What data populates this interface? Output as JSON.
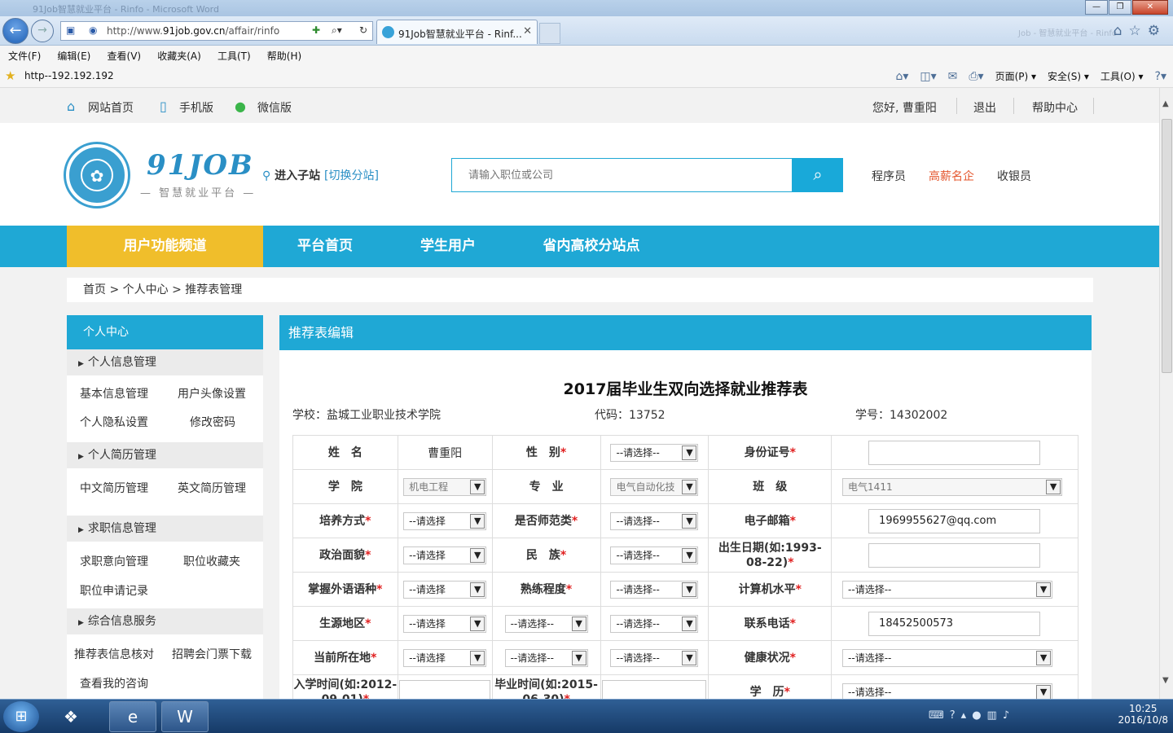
{
  "browser": {
    "title_ghost": "91Job智慧就业平台 - Rinfo - Microsoft Word",
    "window_buttons": [
      "—",
      "❐",
      "✕"
    ],
    "address_url_prefix": "http://www.",
    "address_url_domain": "91job.gov.cn",
    "address_url_path": "/affair/rinfo",
    "tab_title": "91Job智慧就业平台 - Rinf...",
    "tab_close": "✕",
    "right_ghost": "Job - 智慧就业平台 - Rinfo",
    "menu": [
      "文件(F)",
      "编辑(E)",
      "查看(V)",
      "收藏夹(A)",
      "工具(T)",
      "帮助(H)"
    ],
    "favorite": "http--192.192.192",
    "commands": [
      "页面(P) ▾",
      "安全(S) ▾",
      "工具(O) ▾"
    ]
  },
  "topbar": {
    "home": "网站首页",
    "mobile": "手机版",
    "wechat": "微信版",
    "greeting": "您好, 曹重阳",
    "logout": "退出",
    "help": "帮助中心"
  },
  "header": {
    "logo_text": "91JOB",
    "logo_sub": "— 智慧就业平台 —",
    "region_label": "进入子站",
    "region_switch": "[切换分站]",
    "search_placeholder": "请输入职位或公司",
    "hot_links": [
      "程序员",
      "高薪名企",
      "收银员"
    ]
  },
  "mainnav": {
    "items": [
      "用户功能频道",
      "平台首页",
      "学生用户",
      "省内高校分站点"
    ]
  },
  "breadcrumb": {
    "home": "首页",
    "sep": ">",
    "personal": "个人中心",
    "current": "推荐表管理"
  },
  "sidebar": {
    "title": "个人中心",
    "groups": [
      {
        "title": "个人信息管理",
        "items": [
          "基本信息管理",
          "用户头像设置",
          "个人隐私设置",
          "修改密码"
        ]
      },
      {
        "title": "个人简历管理",
        "items": [
          "中文简历管理",
          "英文简历管理"
        ]
      },
      {
        "title": "求职信息管理",
        "items": [
          "求职意向管理",
          "职位收藏夹",
          "职位申请记录"
        ]
      },
      {
        "title": "综合信息服务",
        "items": [
          "推荐表信息核对",
          "招聘会门票下载",
          "查看我的咨询"
        ]
      }
    ]
  },
  "panel": {
    "title": "推荐表编辑",
    "form_title": "2017届毕业生双向选择就业推荐表",
    "school": "学校：盐城工业职业技术学院",
    "code": "代码：13752",
    "student_no": "学号：14302002"
  },
  "form": {
    "req": "*",
    "name_label": "姓　名",
    "name_value": "曹重阳",
    "gender_label": "性　别",
    "gender_value": "--请选择--",
    "id_label": "身份证号",
    "id_value": "",
    "college_label": "学　院",
    "college_value": "机电工程",
    "major_label": "专　业",
    "major_value": "电气自动化技",
    "class_label": "班　级",
    "class_value": "电气1411",
    "training_label": "培养方式",
    "training_value": "--请选择",
    "normal_label": "是否师范类",
    "normal_value": "--请选择--",
    "email_label": "电子邮箱",
    "email_value": "1969955627@qq.com",
    "political_label": "政治面貌",
    "political_value": "--请选择",
    "nation_label": "民　族",
    "nation_value": "--请选择--",
    "birth_label": "出生日期(如:1993-08-22)",
    "birth_value": "",
    "lang_label": "掌握外语语种",
    "lang_value": "--请选择",
    "skill_label": "熟练程度",
    "skill_value": "--请选择--",
    "computer_label": "计算机水平",
    "computer_value": "--请选择--",
    "origin_label": "生源地区",
    "origin_value1": "--请选择",
    "origin_value2": "--请选择--",
    "origin_value3": "--请选择--",
    "phone_label": "联系电话",
    "phone_value": "18452500573",
    "current_label": "当前所在地",
    "current_value1": "--请选择",
    "current_value2": "--请选择--",
    "current_value3": "--请选择--",
    "health_label": "健康状况",
    "health_value": "--请选择--",
    "enroll_label": "入学时间(如:2012-09-01)",
    "enroll_value": "",
    "grad_label": "毕业时间(如:2015-06-30)",
    "grad_value": "",
    "edu_label": "学　历",
    "edu_value": "--请选择--"
  },
  "taskbar": {
    "time": "10:25",
    "date": "2016/10/8"
  },
  "colors": {
    "accent": "#1fa8d5",
    "active_nav": "#f0be2b",
    "required": "#e02020",
    "hot_red": "#e4572e"
  }
}
